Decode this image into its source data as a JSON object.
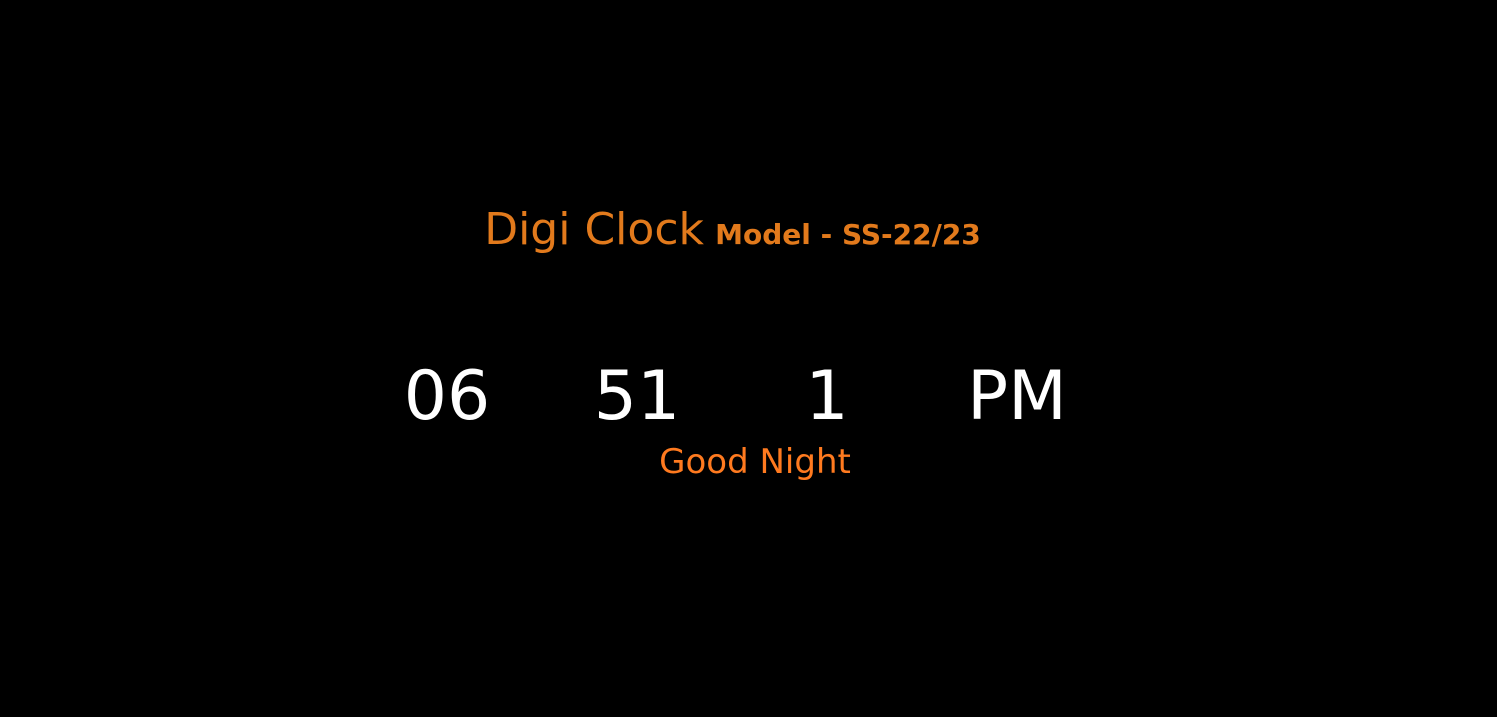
{
  "header": {
    "title": "Digi Clock",
    "model": "Model - SS-22/23"
  },
  "clock": {
    "hours": "06",
    "minutes": "51",
    "seconds": "1",
    "period": "PM"
  },
  "greeting": "Good Night",
  "colors": {
    "background": "#000000",
    "accent": "#e27a1c",
    "greeting": "#ff7a1f",
    "digits": "#ffffff"
  }
}
